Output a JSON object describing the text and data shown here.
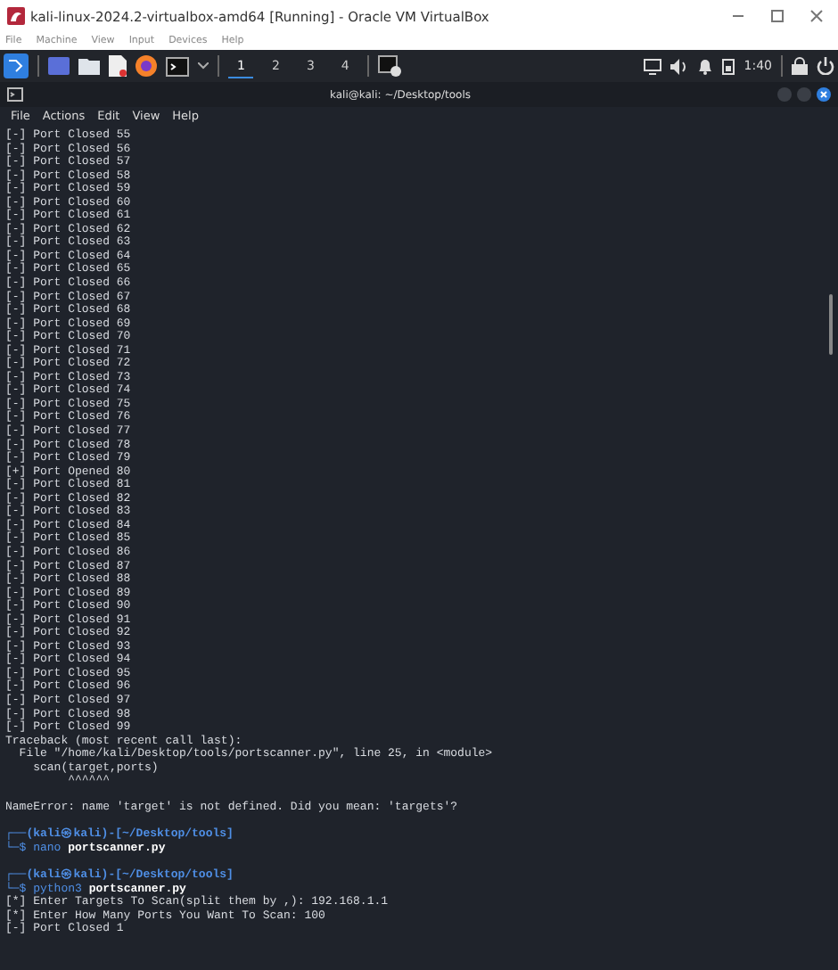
{
  "host_window": {
    "title": "kali-linux-2024.2-virtualbox-amd64 [Running] - Oracle VM VirtualBox",
    "menu": [
      "File",
      "Machine",
      "View",
      "Input",
      "Devices",
      "Help"
    ]
  },
  "panel": {
    "workspaces": [
      {
        "label": "1",
        "selected": true
      },
      {
        "label": "2",
        "selected": false
      },
      {
        "label": "3",
        "selected": false
      },
      {
        "label": "4",
        "selected": false
      }
    ],
    "clock": "1:40"
  },
  "terminal": {
    "title": "kali@kali: ~/Desktop/tools",
    "menu": [
      "File",
      "Actions",
      "Edit",
      "View",
      "Help"
    ],
    "lines": [
      {
        "kind": "text",
        "text": "[-] Port Closed 55"
      },
      {
        "kind": "text",
        "text": "[-] Port Closed 56"
      },
      {
        "kind": "text",
        "text": "[-] Port Closed 57"
      },
      {
        "kind": "text",
        "text": "[-] Port Closed 58"
      },
      {
        "kind": "text",
        "text": "[-] Port Closed 59"
      },
      {
        "kind": "text",
        "text": "[-] Port Closed 60"
      },
      {
        "kind": "text",
        "text": "[-] Port Closed 61"
      },
      {
        "kind": "text",
        "text": "[-] Port Closed 62"
      },
      {
        "kind": "text",
        "text": "[-] Port Closed 63"
      },
      {
        "kind": "text",
        "text": "[-] Port Closed 64"
      },
      {
        "kind": "text",
        "text": "[-] Port Closed 65"
      },
      {
        "kind": "text",
        "text": "[-] Port Closed 66"
      },
      {
        "kind": "text",
        "text": "[-] Port Closed 67"
      },
      {
        "kind": "text",
        "text": "[-] Port Closed 68"
      },
      {
        "kind": "text",
        "text": "[-] Port Closed 69"
      },
      {
        "kind": "text",
        "text": "[-] Port Closed 70"
      },
      {
        "kind": "text",
        "text": "[-] Port Closed 71"
      },
      {
        "kind": "text",
        "text": "[-] Port Closed 72"
      },
      {
        "kind": "text",
        "text": "[-] Port Closed 73"
      },
      {
        "kind": "text",
        "text": "[-] Port Closed 74"
      },
      {
        "kind": "text",
        "text": "[-] Port Closed 75"
      },
      {
        "kind": "text",
        "text": "[-] Port Closed 76"
      },
      {
        "kind": "text",
        "text": "[-] Port Closed 77"
      },
      {
        "kind": "text",
        "text": "[-] Port Closed 78"
      },
      {
        "kind": "text",
        "text": "[-] Port Closed 79"
      },
      {
        "kind": "text",
        "text": "[+] Port Opened 80"
      },
      {
        "kind": "text",
        "text": "[-] Port Closed 81"
      },
      {
        "kind": "text",
        "text": "[-] Port Closed 82"
      },
      {
        "kind": "text",
        "text": "[-] Port Closed 83"
      },
      {
        "kind": "text",
        "text": "[-] Port Closed 84"
      },
      {
        "kind": "text",
        "text": "[-] Port Closed 85"
      },
      {
        "kind": "text",
        "text": "[-] Port Closed 86"
      },
      {
        "kind": "text",
        "text": "[-] Port Closed 87"
      },
      {
        "kind": "text",
        "text": "[-] Port Closed 88"
      },
      {
        "kind": "text",
        "text": "[-] Port Closed 89"
      },
      {
        "kind": "text",
        "text": "[-] Port Closed 90"
      },
      {
        "kind": "text",
        "text": "[-] Port Closed 91"
      },
      {
        "kind": "text",
        "text": "[-] Port Closed 92"
      },
      {
        "kind": "text",
        "text": "[-] Port Closed 93"
      },
      {
        "kind": "text",
        "text": "[-] Port Closed 94"
      },
      {
        "kind": "text",
        "text": "[-] Port Closed 95"
      },
      {
        "kind": "text",
        "text": "[-] Port Closed 96"
      },
      {
        "kind": "text",
        "text": "[-] Port Closed 97"
      },
      {
        "kind": "text",
        "text": "[-] Port Closed 98"
      },
      {
        "kind": "text",
        "text": "[-] Port Closed 99"
      },
      {
        "kind": "text",
        "text": "Traceback (most recent call last):"
      },
      {
        "kind": "text",
        "text": "  File \"/home/kali/Desktop/tools/portscanner.py\", line 25, in <module>"
      },
      {
        "kind": "text",
        "text": "    scan(target,ports)"
      },
      {
        "kind": "text",
        "text": "         ^^^^^^"
      },
      {
        "kind": "blank"
      },
      {
        "kind": "text",
        "text": "NameError: name 'target' is not defined. Did you mean: 'targets'?"
      },
      {
        "kind": "blank"
      },
      {
        "kind": "prompt",
        "text": "┌──(kali㉿kali)-[~/Desktop/tools]"
      },
      {
        "kind": "command",
        "prefix": "└─$",
        "program": "nano",
        "args": "portscanner.py"
      },
      {
        "kind": "blank"
      },
      {
        "kind": "prompt",
        "text": "┌──(kali㉿kali)-[~/Desktop/tools]"
      },
      {
        "kind": "command",
        "prefix": "└─$",
        "program": "python3",
        "args": "portscanner.py"
      },
      {
        "kind": "text",
        "text": "[*] Enter Targets To Scan(split them by ,): 192.168.1.1"
      },
      {
        "kind": "text",
        "text": "[*] Enter How Many Ports You Want To Scan: 100"
      },
      {
        "kind": "text",
        "text": "[-] Port Closed 1"
      }
    ]
  }
}
